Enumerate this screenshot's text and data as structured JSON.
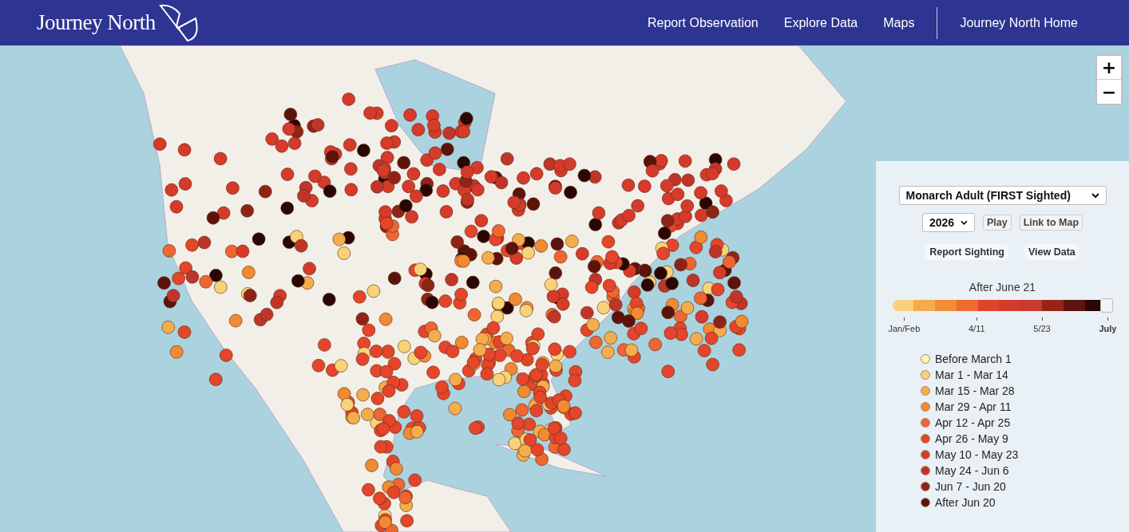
{
  "header": {
    "logo_text": "Journey North",
    "nav": [
      {
        "label": "Report Observation"
      },
      {
        "label": "Explore Data"
      },
      {
        "label": "Maps"
      },
      {
        "label": "Journey North Home",
        "kind": "separated"
      }
    ]
  },
  "map_controls": {
    "zoom_in": "+",
    "zoom_out": "−"
  },
  "panel": {
    "species_select": "Monarch Adult (FIRST Sighted)",
    "year_select": "2026",
    "buttons": [
      "Play",
      "Link to Map"
    ],
    "links": [
      "Report Sighting",
      "View Data"
    ],
    "slider": {
      "caption": "After June 21",
      "level": 1,
      "ticks": [
        {
          "label": "Jan/Feb",
          "selected": false
        },
        {
          "label": "4/11",
          "selected": false
        },
        {
          "label": "5/23",
          "selected": false
        },
        {
          "label": "July",
          "selected": true
        }
      ]
    },
    "legend": [
      {
        "label": "Before March 1",
        "color": "#fdf5b3"
      },
      {
        "label": "Mar 1 - Mar 14",
        "color": "#f8d277"
      },
      {
        "label": "Mar 15 - Mar 28",
        "color": "#f4ad4c"
      },
      {
        "label": "Mar 29 - Apr 11",
        "color": "#f18a31"
      },
      {
        "label": "Apr 12 - Apr 25",
        "color": "#ee6631"
      },
      {
        "label": "Apr 26 - May 9",
        "color": "#e4452b"
      },
      {
        "label": "May 10 - May 23",
        "color": "#d63a2a"
      },
      {
        "label": "May 24 - Jun 6",
        "color": "#c0352a"
      },
      {
        "label": "Jun 7 - Jun 20",
        "color": "#8e2417"
      },
      {
        "label": "After Jun 20",
        "color": "#5c130b"
      }
    ]
  }
}
